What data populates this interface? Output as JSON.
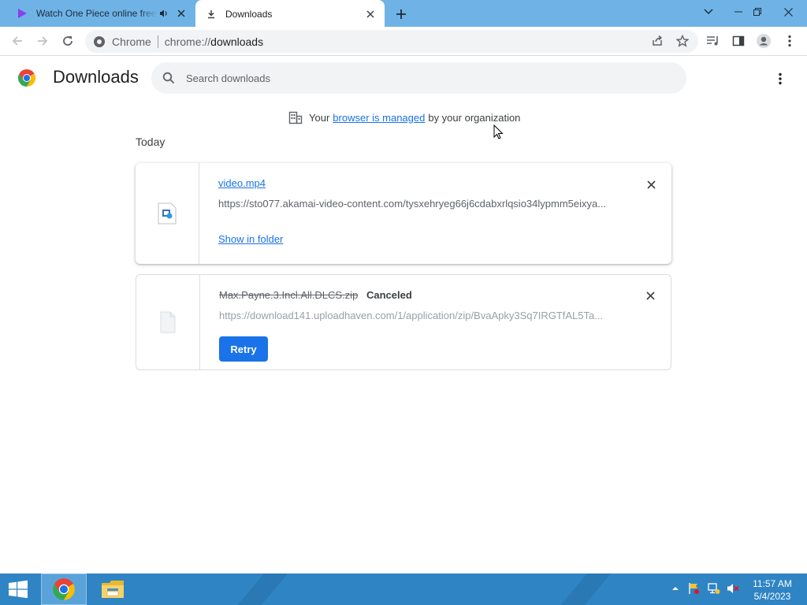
{
  "tabs": [
    {
      "title": "Watch One Piece online free",
      "active": false,
      "audio": true
    },
    {
      "title": "Downloads",
      "active": true
    }
  ],
  "toolbar": {
    "site_name": "Chrome",
    "url_scheme": "chrome://",
    "url_path": "downloads"
  },
  "page": {
    "title": "Downloads",
    "search_placeholder": "Search downloads",
    "managed": {
      "prefix": "Your",
      "link": "browser is managed",
      "suffix": "by your organization"
    },
    "section_label": "Today"
  },
  "downloads": [
    {
      "filename": "video.mp4",
      "url": "https://sto077.akamai-video-content.com/tysxehryeg66j6cdabxrlqsio34lypmm5eixya...",
      "action": "Show in folder"
    },
    {
      "filename": "Max.Payne.3.Incl.All.DLCS.zip",
      "status": "Canceled",
      "url": "https://download141.uploadhaven.com/1/application/zip/BvaApky3Sq7IRGTfAL5Ta...",
      "action": "Retry"
    }
  ],
  "taskbar": {
    "time": "11:57 AM",
    "date": "5/4/2023"
  },
  "colors": {
    "tabstrip": "#6fb3e6",
    "link": "#1a73e8",
    "taskbar": "#2f84c4"
  }
}
